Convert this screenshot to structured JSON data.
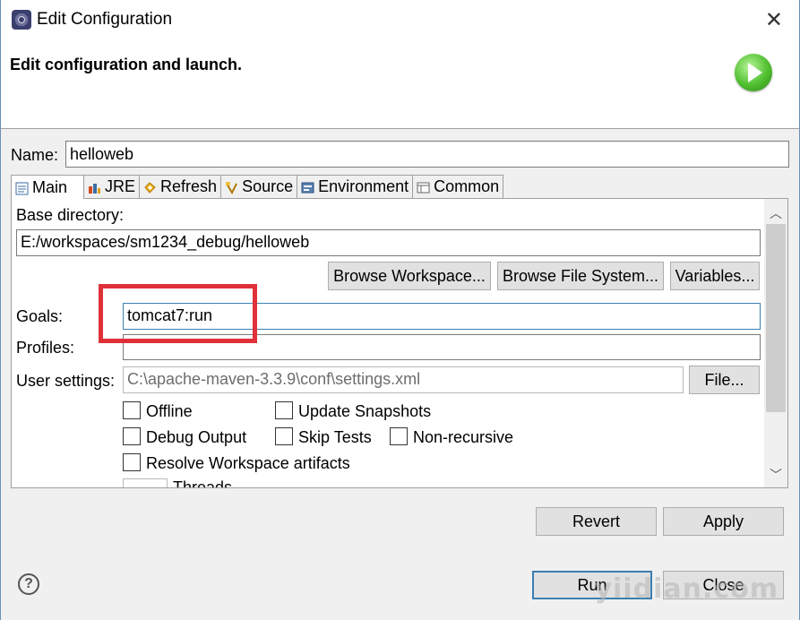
{
  "window": {
    "title": "Edit Configuration",
    "close": "✕"
  },
  "header": {
    "title": "Edit configuration and launch."
  },
  "name": {
    "label": "Name:",
    "value": "helloweb"
  },
  "tabs": [
    {
      "label": "Main",
      "icon": "main-tab-icon"
    },
    {
      "label": "JRE",
      "icon": "jre-icon"
    },
    {
      "label": "Refresh",
      "icon": "refresh-icon"
    },
    {
      "label": "Source",
      "icon": "source-icon"
    },
    {
      "label": "Environment",
      "icon": "environment-icon"
    },
    {
      "label": "Common",
      "icon": "common-icon"
    }
  ],
  "main": {
    "base_directory_label": "Base directory:",
    "base_directory_value": "E:/workspaces/sm1234_debug/helloweb",
    "browse_workspace": "Browse Workspace...",
    "browse_file_system": "Browse File System...",
    "variables": "Variables...",
    "goals_label": "Goals:",
    "goals_value": "tomcat7:run",
    "profiles_label": "Profiles:",
    "profiles_value": "",
    "user_settings_label": "User settings:",
    "user_settings_value": "C:\\apache-maven-3.3.9\\conf\\settings.xml",
    "file_button": "File...",
    "checkboxes": {
      "offline": "Offline",
      "update_snapshots": "Update Snapshots",
      "debug_output": "Debug Output",
      "skip_tests": "Skip Tests",
      "non_recursive": "Non-recursive",
      "resolve_workspace": "Resolve Workspace artifacts"
    },
    "threads_partial": "Threads"
  },
  "buttons": {
    "revert": "Revert",
    "apply": "Apply",
    "run": "Run",
    "close": "Close"
  },
  "watermark": "yiidian.com",
  "help": "?",
  "colors": {
    "highlight": "#e0303a",
    "focus": "#3c7fb1"
  }
}
